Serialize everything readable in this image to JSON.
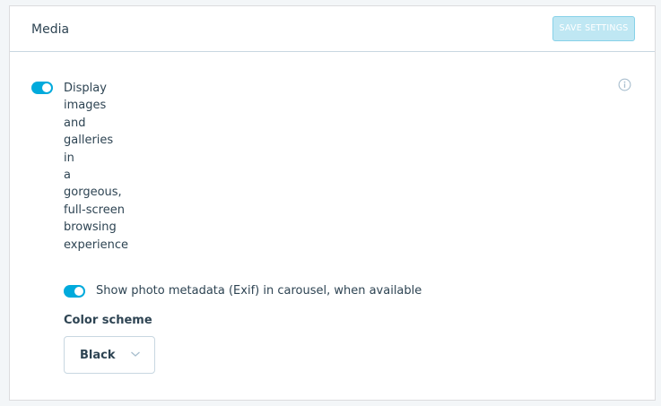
{
  "card": {
    "title": "Media",
    "save_label": "SAVE SETTINGS",
    "info_icon": "info-circle-icon"
  },
  "carousel": {
    "enabled": true,
    "label": "Display images and galleries in a gorgeous, full-screen browsing experience"
  },
  "exif": {
    "enabled": true,
    "label": "Show photo metadata (Exif) in carousel, when available"
  },
  "color_scheme": {
    "label": "Color scheme",
    "selected": "Black"
  },
  "colors": {
    "accent": "#00aadc",
    "text": "#2e4453",
    "border": "#c8d7e1",
    "save_disabled_bg": "#bfe7f3"
  }
}
